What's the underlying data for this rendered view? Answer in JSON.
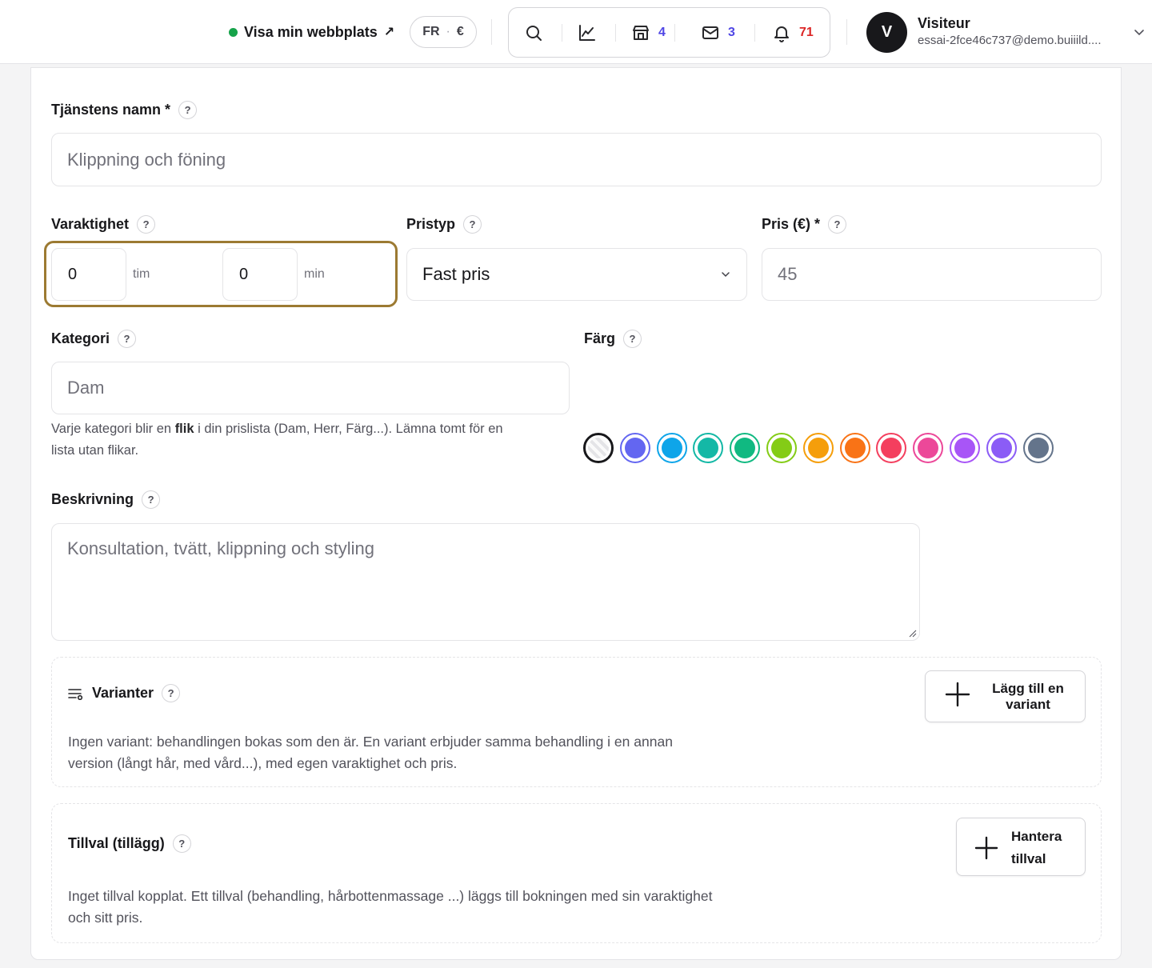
{
  "header": {
    "visit_site": "Visa min webbplats",
    "visit_arrow": "↗",
    "lang": "FR",
    "lang_sep": "·",
    "currency": "€",
    "shop_count": "4",
    "mail_count": "3",
    "notif_count": "71",
    "avatar_letter": "V",
    "user_name": "Visiteur",
    "user_email": "essai-2fce46c737@demo.buiiild...."
  },
  "form": {
    "name_label": "Tjänstens namn *",
    "name_placeholder": "Klippning och föning",
    "duration_label": "Varaktighet",
    "hours_value": "0",
    "hours_unit": "tim",
    "minutes_value": "0",
    "minutes_unit": "min",
    "pricetype_label": "Pristyp",
    "pricetype_value": "Fast pris",
    "price_label": "Pris (€) *",
    "price_value": "45",
    "category_label": "Kategori",
    "category_placeholder": "Dam",
    "category_hint_1": "Varje kategori blir en ",
    "category_hint_bold": "flik",
    "category_hint_2": " i din prislista (Dam, Herr, Färg...). Lämna tomt för en",
    "category_hint_3": "lista utan flikar.",
    "color_label": "Färg",
    "colors": [
      "none",
      "#6366f1",
      "#0ea5e9",
      "#14b8a6",
      "#10b981",
      "#84cc16",
      "#f59e0b",
      "#f97316",
      "#f43f5e",
      "#ec4899",
      "#a855f7",
      "#8b5cf6",
      "#64748b"
    ],
    "description_label": "Beskrivning",
    "description_placeholder": "Konsultation, tvätt, klippning och styling",
    "help_mark": "?"
  },
  "variants": {
    "title": "Varianter",
    "button_line1": "Lägg till en",
    "button_line2": "variant",
    "text_1": "Ingen variant: behandlingen bokas som den är. En variant erbjuder samma behandling i en annan",
    "text_2": "version (långt hår, med vård...), med egen varaktighet och pris."
  },
  "addons": {
    "title": "Tillval (tillägg)",
    "button_line1": "Hantera",
    "button_line2": "tillval",
    "text_1": "Inget tillval kopplat. Ett tillval (behandling, hårbottenmassage ...) läggs till bokningen med sin varaktighet",
    "text_2": "och sitt pris."
  }
}
